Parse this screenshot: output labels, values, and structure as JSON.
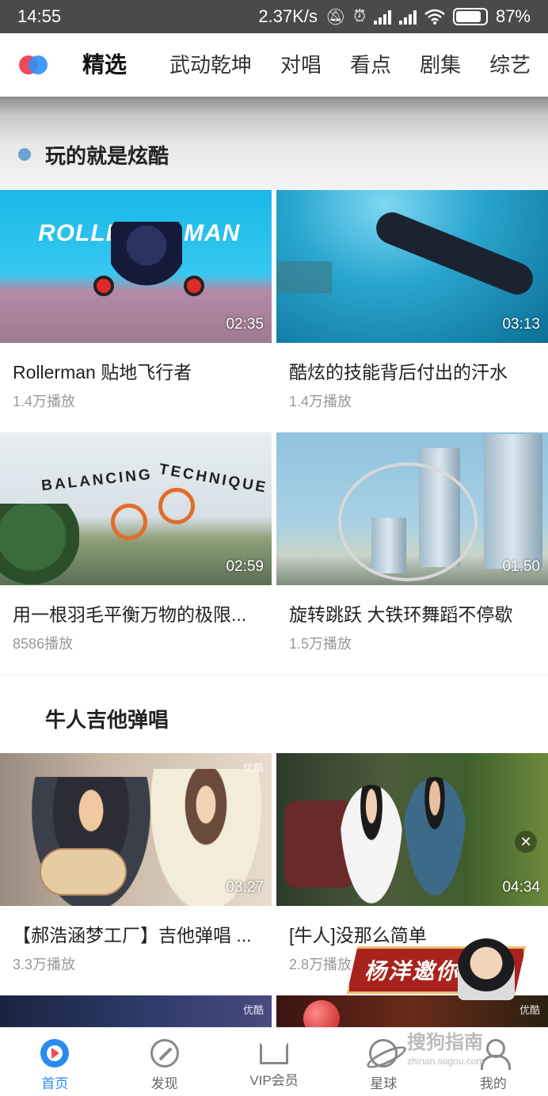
{
  "status_bar": {
    "time": "14:55",
    "net_speed": "2.37K/s",
    "battery": "87%"
  },
  "top_tabs": [
    "精选",
    "武动乾坤",
    "对唱",
    "看点",
    "剧集",
    "综艺"
  ],
  "sections": [
    {
      "title": "玩的就是炫酷",
      "videos": [
        {
          "title": "Rollerman 贴地飞行者",
          "plays": "1.4万播放",
          "duration": "02:35",
          "thumb_text": [
            "ROLLER",
            "MAN"
          ]
        },
        {
          "title": "酷炫的技能背后付出的汗水",
          "plays": "1.4万播放",
          "duration": "03:13"
        },
        {
          "title": "用一根羽毛平衡万物的极限...",
          "plays": "8586播放",
          "duration": "02:59",
          "thumb_text": [
            "BALANCING",
            "TECHNIQUE"
          ]
        },
        {
          "title": "旋转跳跃 大铁环舞蹈不停歇",
          "plays": "1.5万播放",
          "duration": "01:50"
        }
      ]
    },
    {
      "title": "牛人吉他弹唱",
      "videos": [
        {
          "title": "【郝浩涵梦工厂】吉他弹唱 ...",
          "plays": "3.3万播放",
          "duration": "03:27",
          "watermark": "优酷"
        },
        {
          "title": "[牛人]没那么简单",
          "plays": "2.8万播放",
          "duration": "04:34"
        },
        {
          "title": "",
          "plays": "",
          "duration": "",
          "watermark": "优酷"
        },
        {
          "title": "",
          "plays": "",
          "duration": "",
          "watermark": "优酷"
        }
      ]
    }
  ],
  "promo": {
    "text": "杨洋邀你"
  },
  "bottom_tabs": [
    {
      "label": "首页",
      "icon": "home-play-icon"
    },
    {
      "label": "发现",
      "icon": "compass-icon"
    },
    {
      "label": "VIP会员",
      "icon": "crown-icon"
    },
    {
      "label": "星球",
      "icon": "planet-icon"
    },
    {
      "label": "我的",
      "icon": "user-icon"
    }
  ],
  "watermark_site": {
    "name": "搜狗指南",
    "url": "zhinan.sogou.com"
  },
  "colors": {
    "accent": "#2a8af0",
    "logo_red": "#f0485a",
    "logo_blue": "#2f8ff6"
  }
}
